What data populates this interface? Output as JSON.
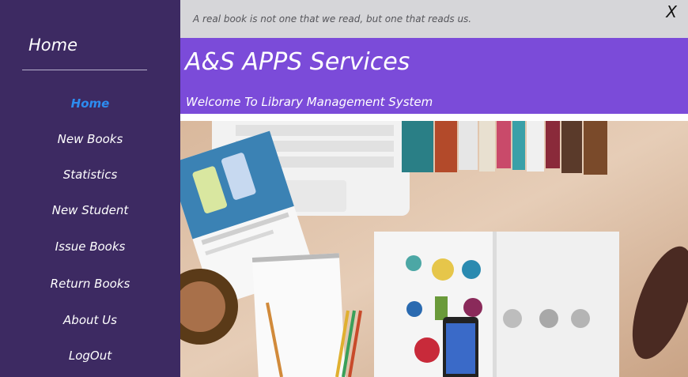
{
  "sidebar": {
    "title": "Home",
    "items": [
      {
        "label": "Home",
        "active": true
      },
      {
        "label": "New Books"
      },
      {
        "label": "Statistics"
      },
      {
        "label": "New Student"
      },
      {
        "label": "Issue Books"
      },
      {
        "label": "Return Books"
      },
      {
        "label": "About Us"
      },
      {
        "label": "LogOut"
      }
    ]
  },
  "header": {
    "quote": "A real book is not one that we read, but one that reads us.",
    "close_label": "X"
  },
  "banner": {
    "title": "A&S APPS Services",
    "subtitle": "Welcome To Library Management System"
  },
  "colors": {
    "sidebar_bg": "#3d2a62",
    "banner_bg": "#7b4bd9",
    "active_nav": "#2d8cf0",
    "quote_bar_bg": "#d6d6d9"
  }
}
